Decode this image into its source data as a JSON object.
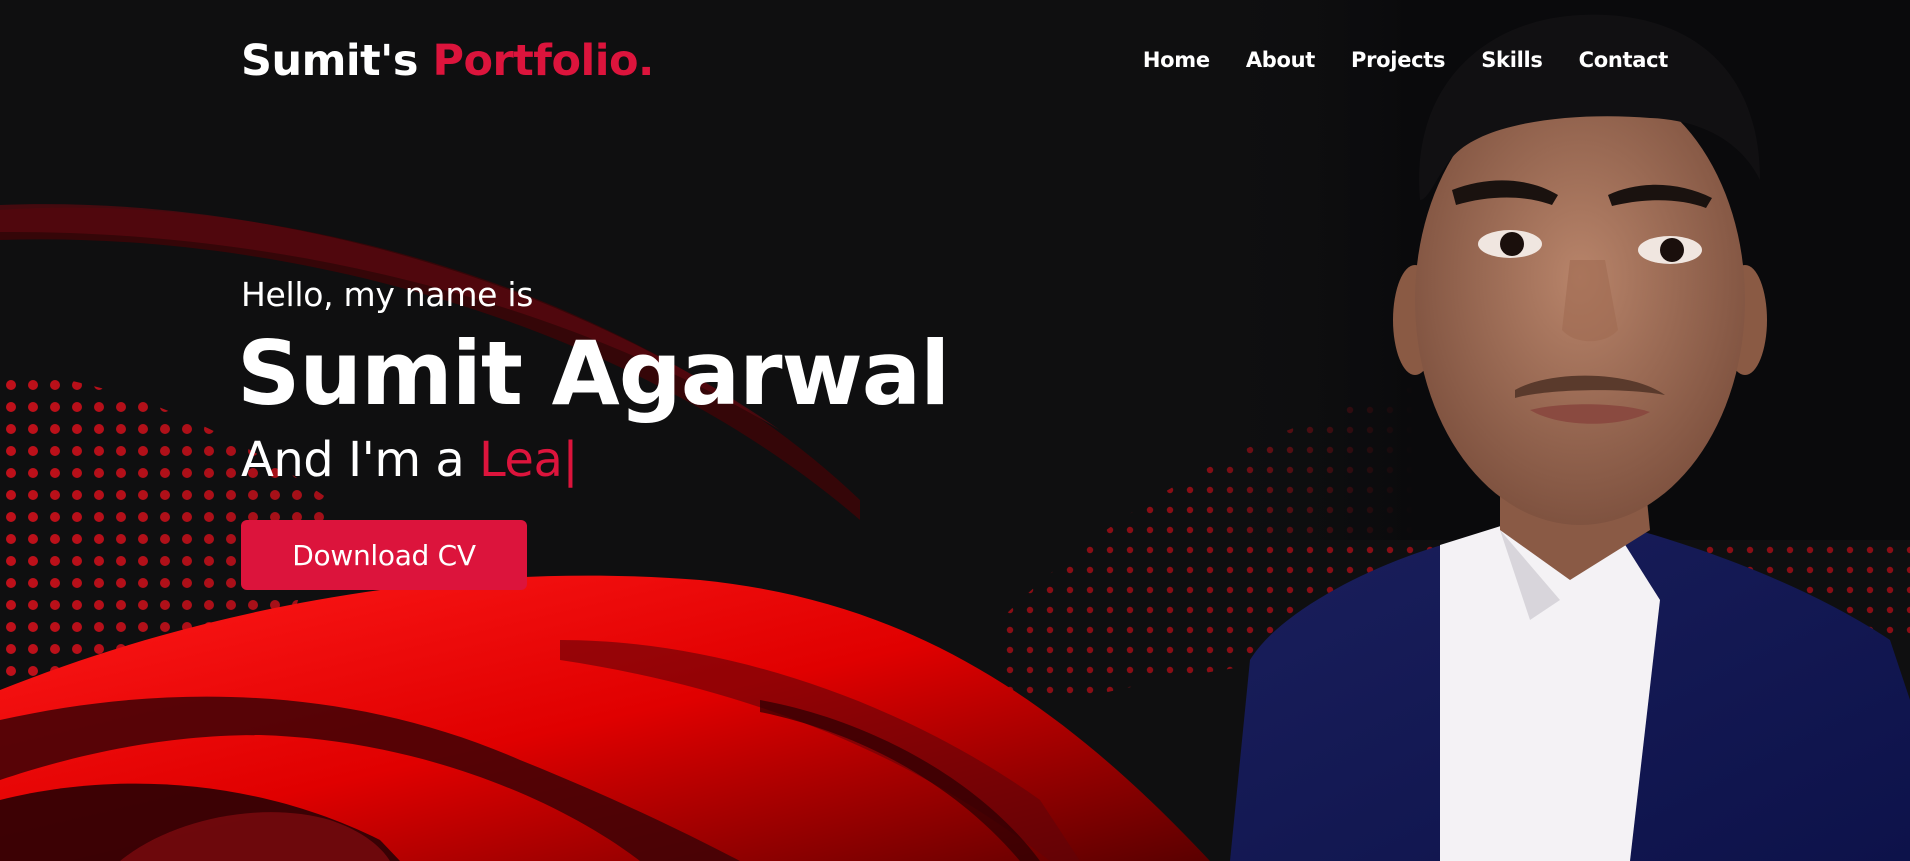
{
  "header": {
    "logo_main": "Sumit's",
    "logo_accent": "Portfolio."
  },
  "nav": {
    "items": [
      {
        "label": "Home"
      },
      {
        "label": "About"
      },
      {
        "label": "Projects"
      },
      {
        "label": "Skills"
      },
      {
        "label": "Contact"
      }
    ]
  },
  "hero": {
    "greeting": "Hello, my name is",
    "name": "Sumit Agarwal",
    "role_prefix": "And I'm a",
    "role_typed": "Lea",
    "cursor": "|",
    "download_label": "Download CV"
  },
  "colors": {
    "accent": "#dc143c",
    "background": "#0f0f10",
    "text": "#ffffff"
  }
}
